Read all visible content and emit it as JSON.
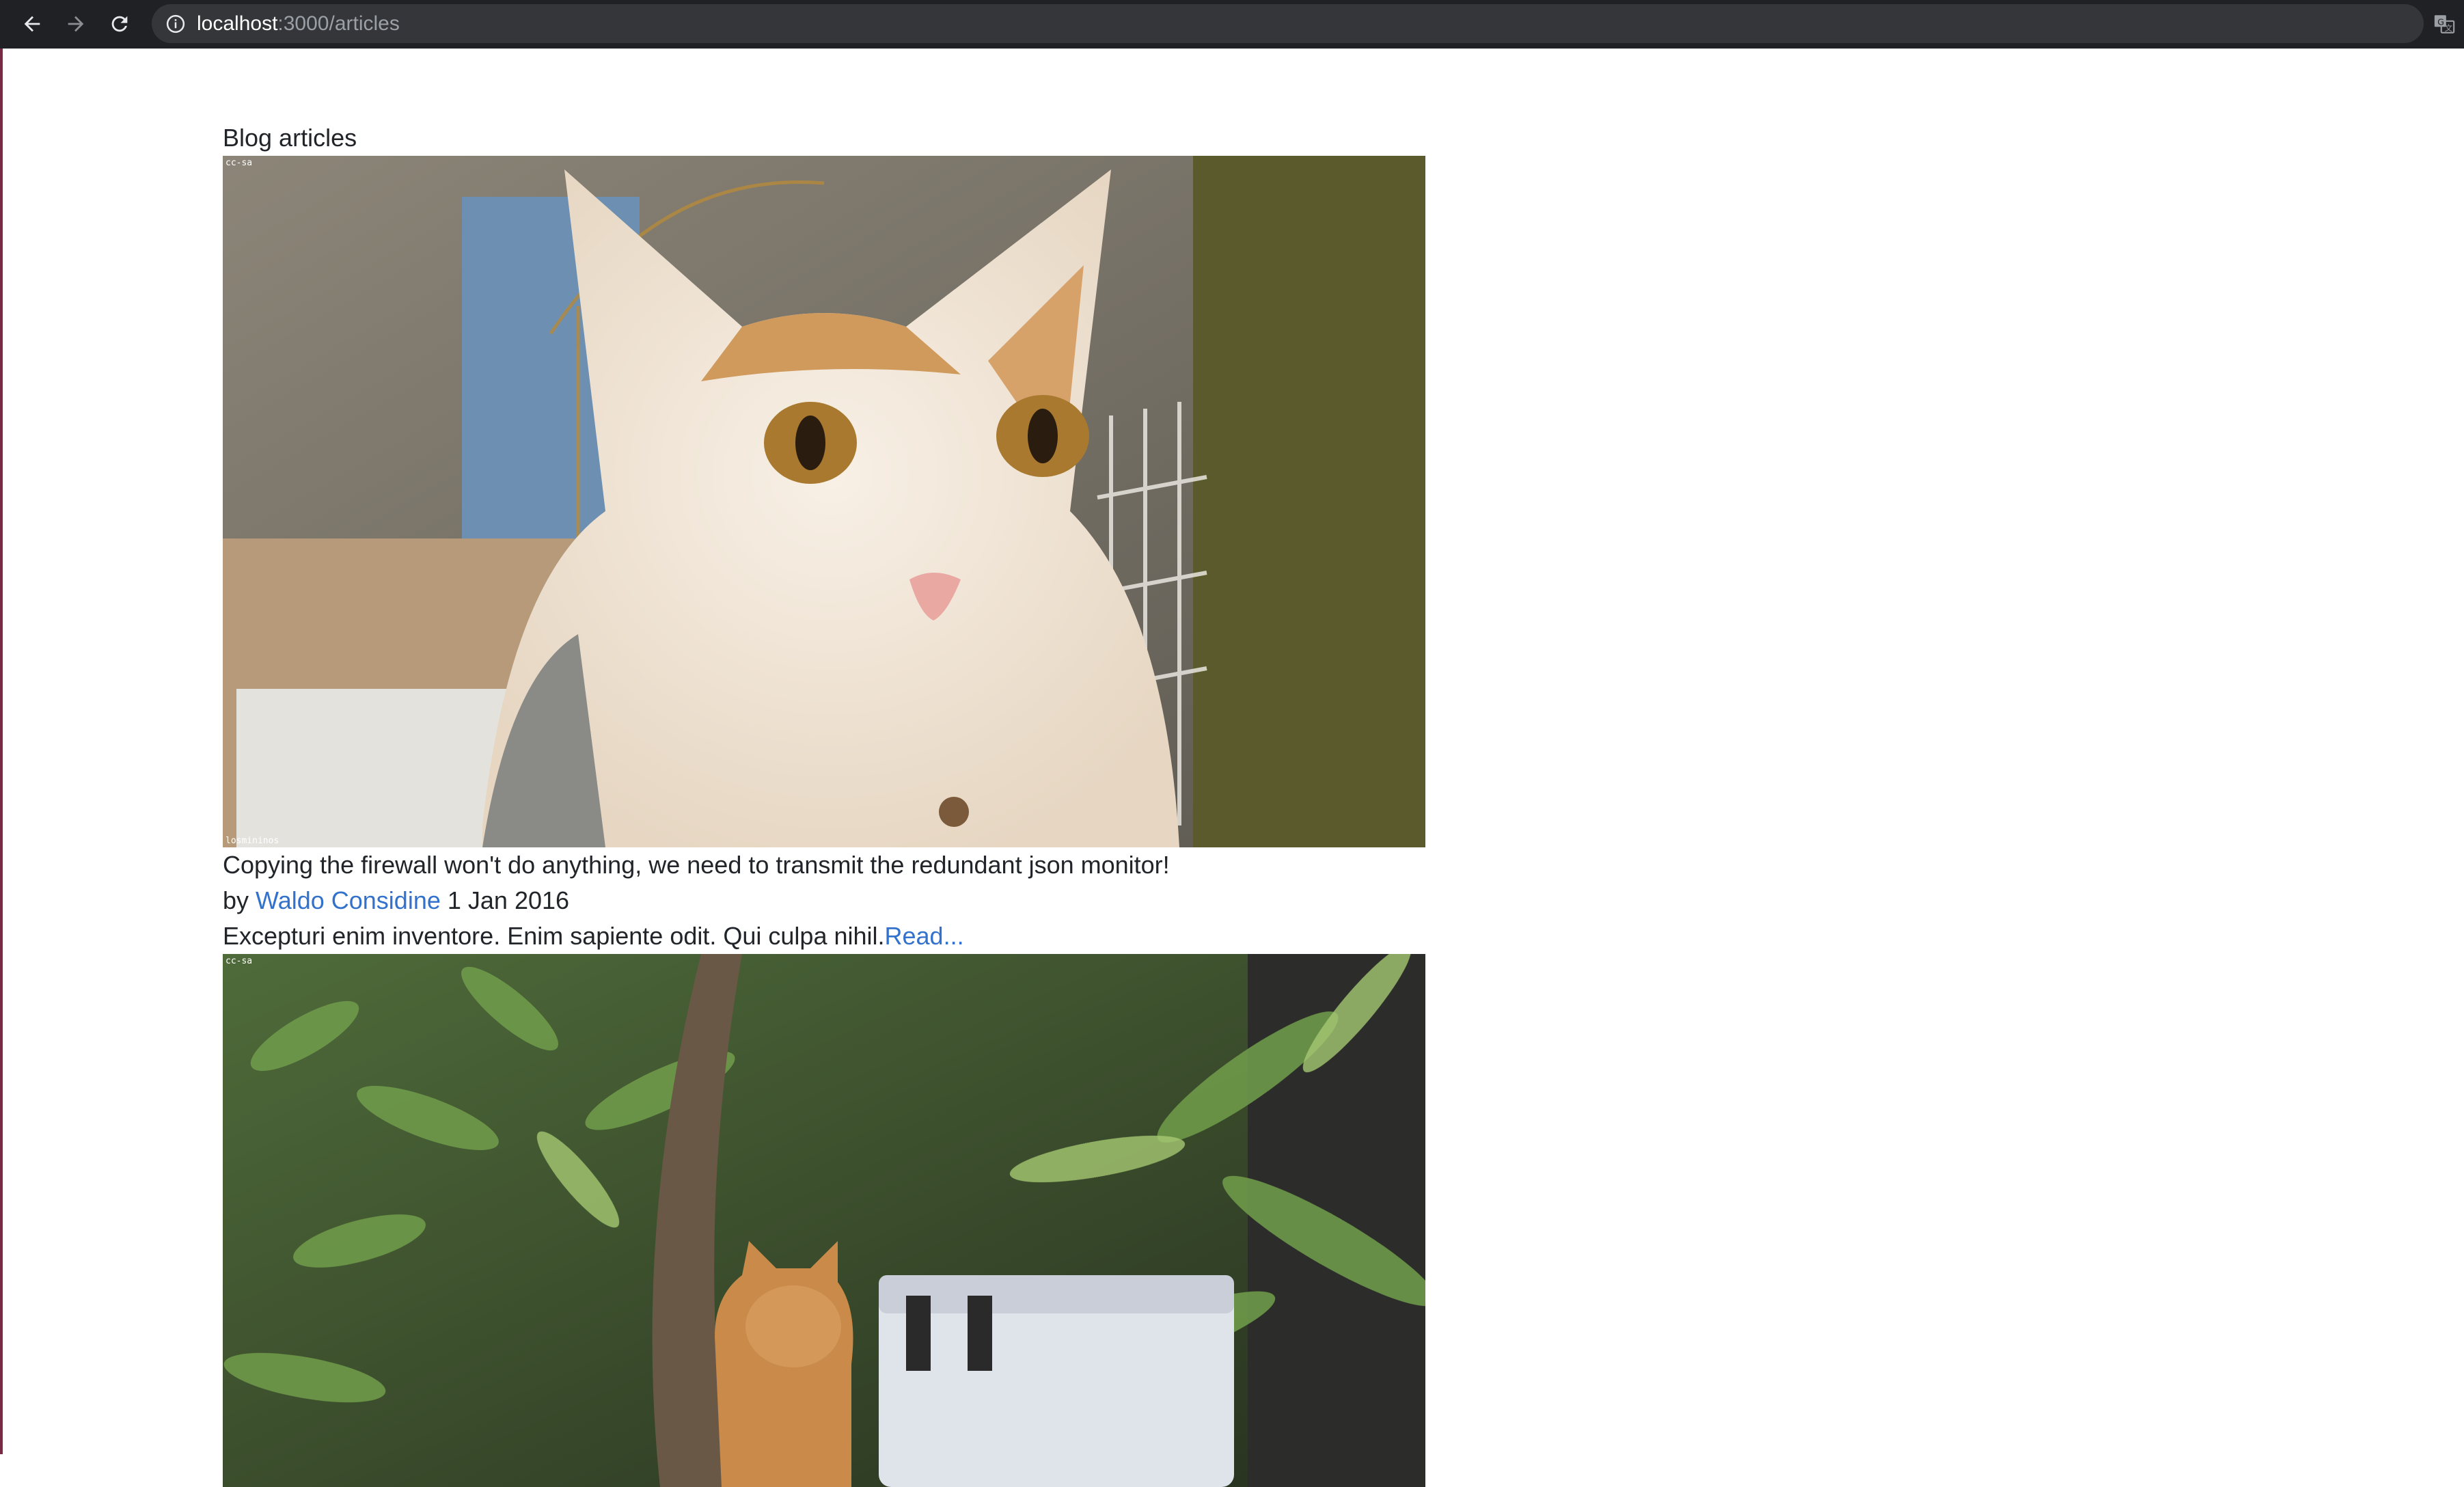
{
  "browser": {
    "url_host": "localhost",
    "url_path": ":3000/articles",
    "icons": [
      "back-arrow-icon",
      "forward-arrow-icon",
      "reload-icon",
      "info-icon",
      "translate-icon"
    ]
  },
  "page": {
    "heading": "Blog articles",
    "articles": [
      {
        "title": "Copying the firewall won't do anything, we need to transmit the redundant json monitor!",
        "by_prefix": "by",
        "author": "Waldo Considine",
        "date": "1 Jan 2016",
        "excerpt": "Excepturi enim inventore. Enim sapiente odit. Qui culpa nihil.",
        "read_more": "Read...",
        "image_caption_top": "cc-sa",
        "image_caption_bottom": "losmininos"
      },
      {
        "image_caption_top": "cc-sa"
      }
    ]
  }
}
